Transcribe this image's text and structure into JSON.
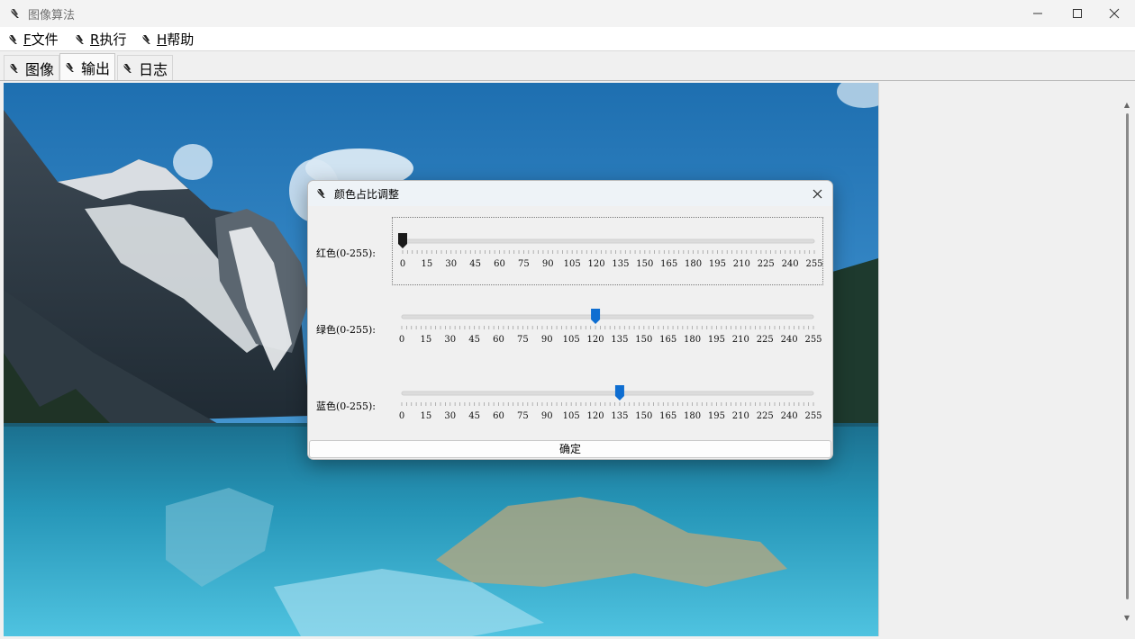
{
  "window": {
    "title": "图像算法",
    "app_icon": "feather-icon",
    "controls": [
      "minimize-icon",
      "maximize-icon",
      "close-icon"
    ]
  },
  "menubar": {
    "items": [
      {
        "key": "F",
        "label": "文件"
      },
      {
        "key": "R",
        "label": "执行"
      },
      {
        "key": "H",
        "label": "帮助"
      }
    ]
  },
  "tabs": [
    {
      "label": "图像",
      "active": false
    },
    {
      "label": "输出",
      "active": true
    },
    {
      "label": "日志",
      "active": false
    }
  ],
  "dialog": {
    "title": "颜色占比调整",
    "sliders": [
      {
        "label": "红色(0-255):",
        "value": 0,
        "color": "#1a1a1a",
        "focused": true
      },
      {
        "label": "绿色(0-255):",
        "value": 120,
        "color": "#0f6ed1",
        "focused": false
      },
      {
        "label": "蓝色(0-255):",
        "value": 135,
        "color": "#0f6ed1",
        "focused": false
      }
    ],
    "slider_min": 0,
    "slider_max": 255,
    "tick_labels": [
      "0",
      "15",
      "30",
      "45",
      "60",
      "75",
      "90",
      "105",
      "120",
      "135",
      "150",
      "165",
      "180",
      "195",
      "210",
      "225",
      "240",
      "255"
    ],
    "ok_label": "确定"
  },
  "colors": {
    "accent": "#0f6ed1",
    "background": "#f0f0f0"
  }
}
